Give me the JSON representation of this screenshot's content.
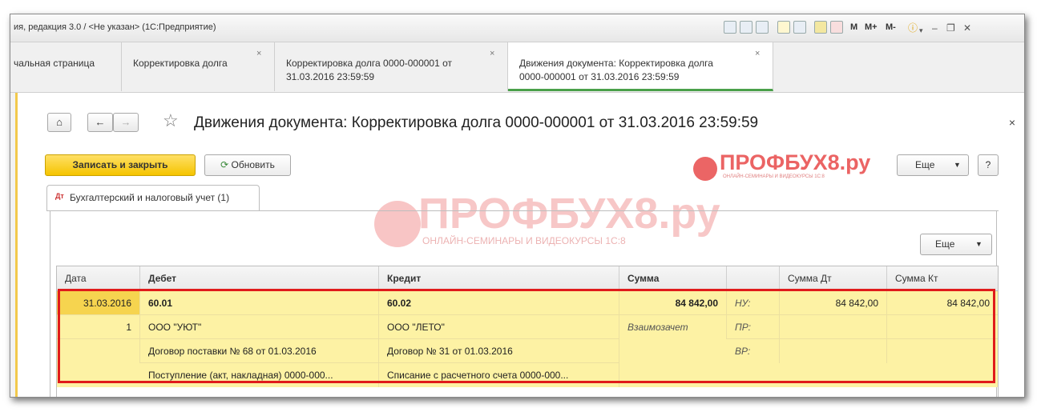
{
  "window": {
    "title": "ия, редакция 3.0 / <Не указан> (1С:Предприятие)",
    "toolbar_labels": [
      "M",
      "M+",
      "M-"
    ]
  },
  "tabs": [
    {
      "label": "чальная страница"
    },
    {
      "label": "Корректировка долга",
      "close": "×"
    },
    {
      "label": "Корректировка долга 0000-000001 от\n31.03.2016 23:59:59",
      "close": "×"
    },
    {
      "label": "Движения документа: Корректировка долга\n0000-000001 от 31.03.2016 23:59:59",
      "close": "×"
    }
  ],
  "doc": {
    "title": "Движения документа: Корректировка долга 0000-000001 от 31.03.2016 23:59:59",
    "close": "×"
  },
  "toolbar": {
    "save_close": "Записать и закрыть",
    "refresh": "Обновить",
    "more": "Еще",
    "help": "?"
  },
  "subtab": {
    "label": "Бухгалтерский и налоговый учет (1)"
  },
  "table": {
    "more": "Еще",
    "headers": [
      "Дата",
      "Дебет",
      "Кредит",
      "Сумма",
      "",
      "Сумма Дт",
      "Сумма Кт"
    ],
    "record": {
      "date": "31.03.2016",
      "num": "1",
      "debit": [
        "60.01",
        "ООО \"УЮТ\"",
        "Договор поставки № 68 от 01.03.2016",
        "Поступление (акт, накладная) 0000-000..."
      ],
      "credit": [
        "60.02",
        "ООО \"ЛЕТО\"",
        "Договор № 31 от 01.03.2016",
        "Списание с расчетного счета 0000-000..."
      ],
      "sum": "84 842,00",
      "content": "Взаимозачет",
      "labels": [
        "НУ:",
        "ПР:",
        "ВР:"
      ],
      "sum_dt": "84 842,00",
      "sum_kt": "84 842,00"
    }
  },
  "watermark": {
    "brand": "ПРОФБУХ8.ру",
    "tagline": "ОНЛАЙН-СЕМИНАРЫ И ВИДЕОКУРСЫ 1С:8",
    "color": "#e84a4a"
  },
  "colors": {
    "accent_yellow": "#f5c400",
    "highlight_row": "#fdf2a4",
    "selection_border": "#e01b1b",
    "active_tab": "#4aa04a"
  }
}
